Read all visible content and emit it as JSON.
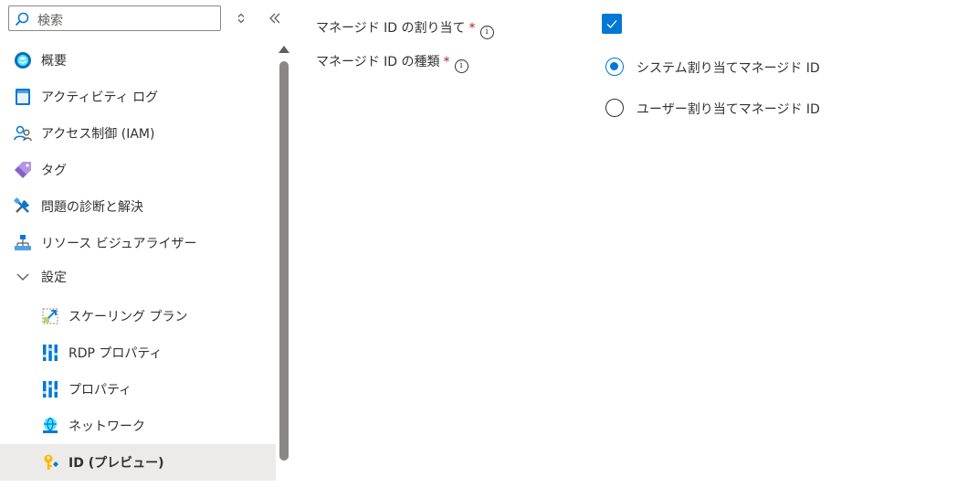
{
  "search": {
    "placeholder": "検索"
  },
  "nav": {
    "overview": "概要",
    "activity_log": "アクティビティ ログ",
    "access_control": "アクセス制御 (IAM)",
    "tags": "タグ",
    "diagnose": "問題の診断と解決",
    "resource_visualizer": "リソース ビジュアライザー",
    "settings": "設定",
    "scaling_plan": "スケーリング プラン",
    "rdp_properties": "RDP プロパティ",
    "properties": "プロパティ",
    "networking": "ネットワーク",
    "identity": "ID (プレビュー)"
  },
  "form": {
    "assign_label": "マネージド ID の割り当て",
    "type_label": "マネージド ID の種類",
    "required_mark": "*",
    "info_glyph": "i",
    "assign_checked": true,
    "options": [
      {
        "label": "システム割り当てマネージド ID",
        "selected": true
      },
      {
        "label": "ユーザー割り当てマネージド ID",
        "selected": false
      }
    ]
  },
  "colors": {
    "accent": "#0078d4",
    "required": "#a4262c",
    "active_bg": "#edebe9"
  }
}
